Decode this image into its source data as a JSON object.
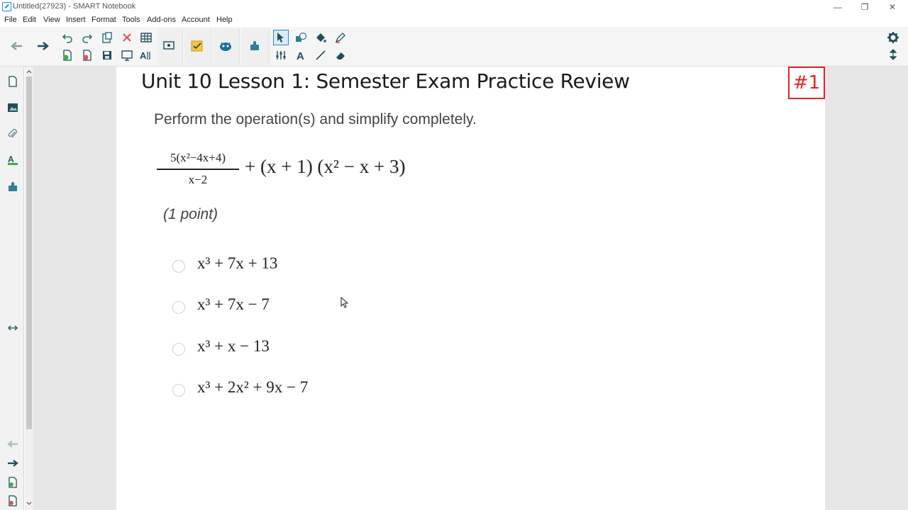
{
  "window": {
    "title": "Untitled(27923) - SMART Notebook"
  },
  "menu": [
    "File",
    "Edit",
    "View",
    "Insert",
    "Format",
    "Tools",
    "Add-ons",
    "Account",
    "Help"
  ],
  "page": {
    "title": "Unit 10 Lesson 1: Semester Exam Practice Review",
    "badge": "#1",
    "instruction": "Perform the operation(s) and simplify completely.",
    "expression": {
      "numerator": "5(x²−4x+4)",
      "denominator": "x−2",
      "rest": "+ (x + 1) (x² − x + 3)"
    },
    "points": "(1 point)",
    "options": [
      "x³ + 7x + 13",
      "x³ + 7x − 7",
      "x³ + x − 13",
      "x³ + 2x² + 9x − 7"
    ]
  },
  "icons": {
    "toolbar": [
      "back-icon",
      "forward-icon",
      "undo-icon",
      "redo-icon",
      "paste-icon",
      "delete-icon",
      "table-icon",
      "add-page-icon",
      "delete-page-icon",
      "save-icon",
      "screen-shade-icon",
      "font-icon",
      "screen-capture-icon",
      "response-icon",
      "activity-icon",
      "addon-icon",
      "select-icon",
      "shapes-icon",
      "fill-icon",
      "pen-icon",
      "properties-icon",
      "text-icon",
      "line-icon",
      "eraser-icon",
      "settings-icon",
      "toolbar-position-icon"
    ],
    "sidebar": [
      "page-sorter-icon",
      "gallery-icon",
      "attachments-icon",
      "properties-icon",
      "addons-icon",
      "resize-icon",
      "back-icon",
      "forward-icon",
      "add-page-icon",
      "delete-page-icon"
    ]
  },
  "colors": {
    "badge": "#e32424",
    "accent": "#1e88e5",
    "icon_dark": "#1f4e5a"
  }
}
